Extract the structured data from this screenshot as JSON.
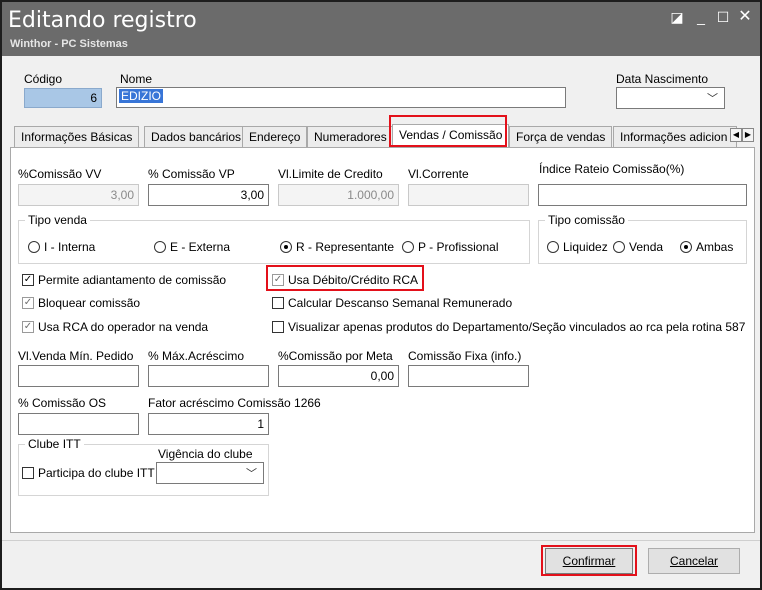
{
  "window": {
    "title": "Editando registro",
    "subtitle": "Winthor - PC Sistemas"
  },
  "header": {
    "codigo_label": "Código",
    "codigo_value": "6",
    "nome_label": "Nome",
    "nome_value": "EDIZIO",
    "nasc_label": "Data Nascimento",
    "nasc_value": ""
  },
  "tabs": [
    {
      "label": "Informações Básicas",
      "active": false
    },
    {
      "label": "Dados bancários",
      "active": false
    },
    {
      "label": "Endereço",
      "active": false
    },
    {
      "label": "Numeradores",
      "active": false
    },
    {
      "label": "Vendas  / Comissão",
      "active": true
    },
    {
      "label": "Força de vendas",
      "active": false
    },
    {
      "label": "Informações adicion",
      "active": false
    }
  ],
  "comissao": {
    "vv_label": "%Comissão VV",
    "vv_value": "3,00",
    "vp_label": "% Comissão VP",
    "vp_value": "3,00",
    "limite_label": "Vl.Limite de Credito",
    "limite_value": "1.000,00",
    "corrente_label": "Vl.Corrente",
    "corrente_value": "",
    "rateio_label": "Índice Rateio Comissão(%)",
    "rateio_value": ""
  },
  "tipo_venda": {
    "label": "Tipo venda",
    "options": [
      {
        "label": "I - Interna",
        "selected": false
      },
      {
        "label": "E - Externa",
        "selected": false
      },
      {
        "label": "R - Representante",
        "selected": true
      },
      {
        "label": "P - Profissional",
        "selected": false
      }
    ]
  },
  "tipo_comissao": {
    "label": "Tipo comissão",
    "options": [
      {
        "label": "Liquidez",
        "selected": false
      },
      {
        "label": "Venda",
        "selected": false
      },
      {
        "label": "Ambas",
        "selected": true
      }
    ]
  },
  "checks": {
    "adiantamento": {
      "label": "Permite adiantamento de comissão",
      "checked": true
    },
    "debito_credito": {
      "label": "Usa Débito/Crédito RCA",
      "checked": true
    },
    "bloquear": {
      "label": "Bloquear comissão",
      "checked": true
    },
    "descanso": {
      "label": "Calcular Descanso Semanal Remunerado",
      "checked": false
    },
    "rca_operador": {
      "label": "Usa RCA do operador na venda",
      "checked": true
    },
    "visualizar": {
      "label": "Visualizar apenas produtos do Departamento/Seção vinculados ao rca pela rotina 587",
      "checked": false
    }
  },
  "outros": {
    "venda_min_label": "Vl.Venda Mín. Pedido",
    "venda_min_value": "",
    "max_acrescimo_label": "% Máx.Acréscimo",
    "max_acrescimo_value": "",
    "comissao_meta_label": "%Comissão por Meta",
    "comissao_meta_value": "0,00",
    "comissao_fixa_label": "Comissão Fixa (info.)",
    "comissao_fixa_value": "",
    "comissao_os_label": "% Comissão OS",
    "comissao_os_value": "",
    "fator_label": "Fator acréscimo Comissão 1266",
    "fator_value": "1"
  },
  "clube": {
    "label": "Clube ITT",
    "participa_label": "Participa do clube ITT",
    "participa_checked": false,
    "vigencia_label": "Vigência do clube",
    "vigencia_value": ""
  },
  "buttons": {
    "confirmar": "Confirmar",
    "cancelar": "Cancelar"
  },
  "colors": {
    "titlebar": "#6b6b6b",
    "highlight": "#e3101a",
    "selection": "#3875d7"
  }
}
